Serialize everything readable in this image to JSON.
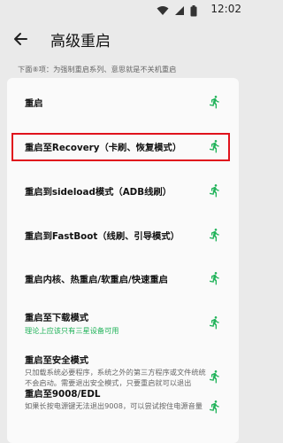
{
  "status_bar": {
    "time": "12:02"
  },
  "header": {
    "title": "高级重启"
  },
  "hint": "下面⑧项：为强制重启系列、意思就是不关机重启",
  "colors": {
    "accent": "#21b35a",
    "highlight": "#e0121c"
  },
  "items": [
    {
      "title": "重启"
    },
    {
      "title": "重启至Recovery（卡刷、恢复模式）"
    },
    {
      "title": "重启到sideload模式（ADB线刷）"
    },
    {
      "title": "重启到FastBoot（线刷、引导模式）"
    },
    {
      "title": "重启内核、热重启/软重启/快速重启"
    },
    {
      "title": "重启至下载模式",
      "subtitle": "理论上应该只有三星设备可用"
    },
    {
      "title": "重启至安全模式",
      "desc": "只加载系统必要程序，系统之外的第三方程序或文件统统不会启动。需要退出安全模式，只要重启就可以退出"
    },
    {
      "title": "重启至9008/EDL",
      "desc": "如果长按电源键无法退出9008，可以尝试按住电源音量"
    }
  ]
}
